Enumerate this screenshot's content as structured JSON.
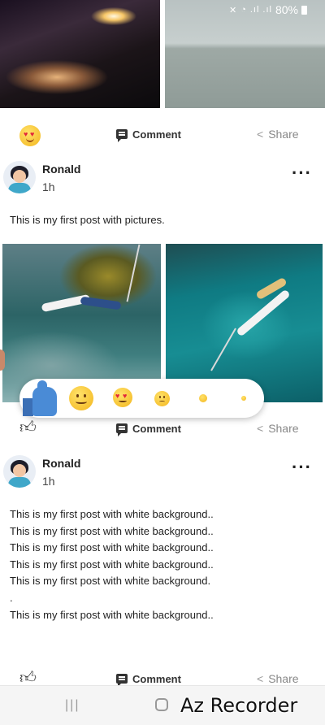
{
  "status_bar": {
    "battery": "80%",
    "icons": [
      "mute-icon",
      "wifi-icon",
      "signal-icon",
      "signal-icon",
      "battery-icon"
    ]
  },
  "post_actions": {
    "comment_label": "Comment",
    "share_label": "Share"
  },
  "posts": [
    {
      "author": "Ronald",
      "time": "1h",
      "text": "This is my first post with pictures."
    },
    {
      "author": "Ronald",
      "time": "1h",
      "lines": [
        "This is my first post with white background..",
        "This is my first post with white background..",
        "This is my first post with white background..",
        "This is my first post with white background..",
        "This is my first post with white background.",
        ".",
        "This is my first post with white background.."
      ]
    }
  ],
  "reactions": [
    "like-icon",
    "smile-icon",
    "heart-eyes-icon",
    "sad-icon",
    "small-emoji-icon",
    "tiny-emoji-icon"
  ],
  "nav": {
    "recent_glyph": "|||"
  },
  "watermark": "Az Recorder"
}
